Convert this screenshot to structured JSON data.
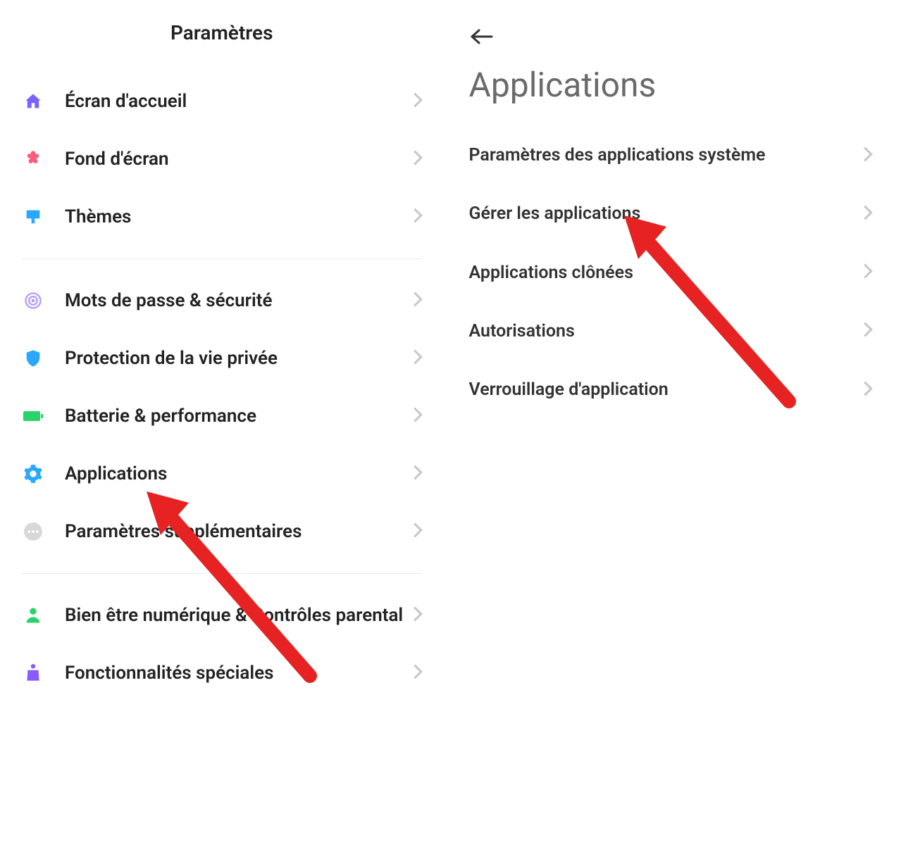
{
  "left": {
    "title": "Paramètres",
    "groups": [
      [
        {
          "icon": "home",
          "color": "#7b61ff",
          "label": "Écran d'accueil"
        },
        {
          "icon": "flower",
          "color": "#ff5a7a",
          "label": "Fond d'écran"
        },
        {
          "icon": "brush",
          "color": "#2aa8ff",
          "label": "Thèmes"
        }
      ],
      [
        {
          "icon": "target",
          "color": "#b49cff",
          "label": "Mots de passe & sécurité"
        },
        {
          "icon": "shield",
          "color": "#2aa8ff",
          "label": "Protection de la vie privée"
        },
        {
          "icon": "battery",
          "color": "#2ad36a",
          "label": "Batterie & performance"
        },
        {
          "icon": "gear",
          "color": "#2aa8ff",
          "label": "Applications"
        },
        {
          "icon": "dots",
          "color": "#c8c8c8",
          "label": "Paramètres supplémentaires"
        }
      ],
      [
        {
          "icon": "person",
          "color": "#2ad36a",
          "label": "Bien être numérique & Contrôles parental"
        },
        {
          "icon": "bag",
          "color": "#8a5cff",
          "label": "Fonctionnalités spéciales"
        }
      ]
    ]
  },
  "right": {
    "title": "Applications",
    "items": [
      {
        "label": "Paramètres des applications système"
      },
      {
        "label": "Gérer les applications"
      },
      {
        "label": "Applications clônées"
      },
      {
        "label": "Autorisations"
      },
      {
        "label": "Verrouillage d'application"
      }
    ]
  },
  "annotations": {
    "arrow_color": "#e62222"
  }
}
